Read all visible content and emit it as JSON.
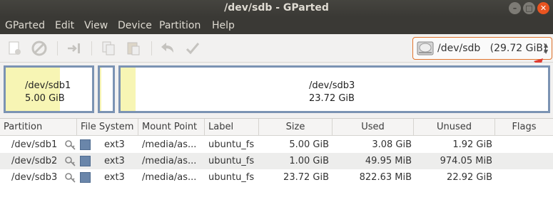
{
  "window": {
    "title": "/dev/sdb - GParted"
  },
  "menu": [
    "GParted",
    "Edit",
    "View",
    "Device",
    "Partition",
    "Help"
  ],
  "toolbar": {
    "buttons": [
      "new-partition",
      "delete-partition",
      "resize-move",
      "copy",
      "paste",
      "undo",
      "apply"
    ]
  },
  "device_selector": {
    "device": "/dev/sdb",
    "size": "(29.72 GiB)"
  },
  "disk_map": {
    "partitions": [
      {
        "name": "/dev/sdb1",
        "size": "5.00 GiB"
      },
      {
        "name": "/dev/sdb2",
        "size": ""
      },
      {
        "name": "/dev/sdb3",
        "size": "23.72 GiB"
      }
    ]
  },
  "table": {
    "headers": {
      "partition": "Partition",
      "filesystem": "File System",
      "mount": "Mount Point",
      "label": "Label",
      "size": "Size",
      "used": "Used",
      "unused": "Unused",
      "flags": "Flags"
    },
    "rows": [
      {
        "partition": "/dev/sdb1",
        "filesystem": "ext3",
        "mount": "/media/as...",
        "label": "ubuntu_fs",
        "size": "5.00 GiB",
        "used": "3.08 GiB",
        "unused": "1.92 GiB",
        "flags": ""
      },
      {
        "partition": "/dev/sdb2",
        "filesystem": "ext3",
        "mount": "/media/as...",
        "label": "ubuntu_fs",
        "size": "1.00 GiB",
        "used": "49.95 MiB",
        "unused": "974.05 MiB",
        "flags": ""
      },
      {
        "partition": "/dev/sdb3",
        "filesystem": "ext3",
        "mount": "/media/as...",
        "label": "ubuntu_fs",
        "size": "23.72 GiB",
        "used": "822.63 MiB",
        "unused": "22.92 GiB",
        "flags": ""
      }
    ]
  },
  "colors": {
    "ext3": "#6a86aa",
    "used": "#f7f5b4",
    "highlight": "#e2742c",
    "annotation": "#e03c31"
  }
}
